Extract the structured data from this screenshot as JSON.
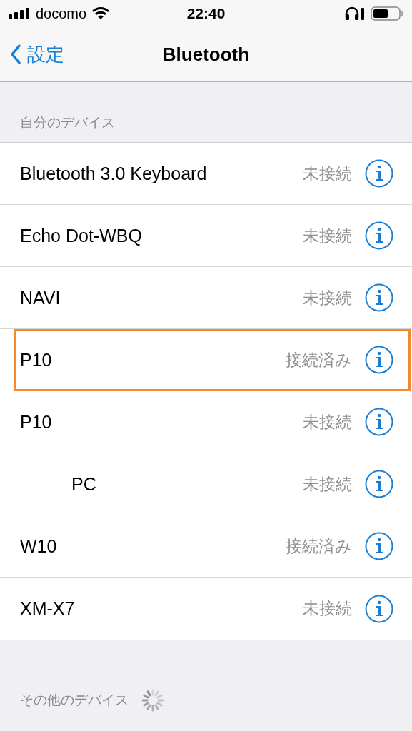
{
  "status_bar": {
    "carrier": "docomo",
    "time": "22:40"
  },
  "nav": {
    "back": "設定",
    "title": "Bluetooth"
  },
  "my_devices": {
    "header": "自分のデバイス",
    "rows": [
      {
        "name": "Bluetooth 3.0 Keyboard",
        "status": "未接続",
        "indented": false,
        "highlighted": false
      },
      {
        "name": "Echo Dot-WBQ",
        "status": "未接続",
        "indented": false,
        "highlighted": false
      },
      {
        "name": "NAVI",
        "status": "未接続",
        "indented": false,
        "highlighted": false
      },
      {
        "name": "P10",
        "status": "接続済み",
        "indented": false,
        "highlighted": true
      },
      {
        "name": "P10",
        "status": "未接続",
        "indented": false,
        "highlighted": false
      },
      {
        "name": "PC",
        "status": "未接続",
        "indented": true,
        "highlighted": false
      },
      {
        "name": "W10",
        "status": "接続済み",
        "indented": false,
        "highlighted": false
      },
      {
        "name": "XM-X7",
        "status": "未接続",
        "indented": false,
        "highlighted": false
      }
    ]
  },
  "other_devices": {
    "header": "その他のデバイス",
    "searching": true
  }
}
